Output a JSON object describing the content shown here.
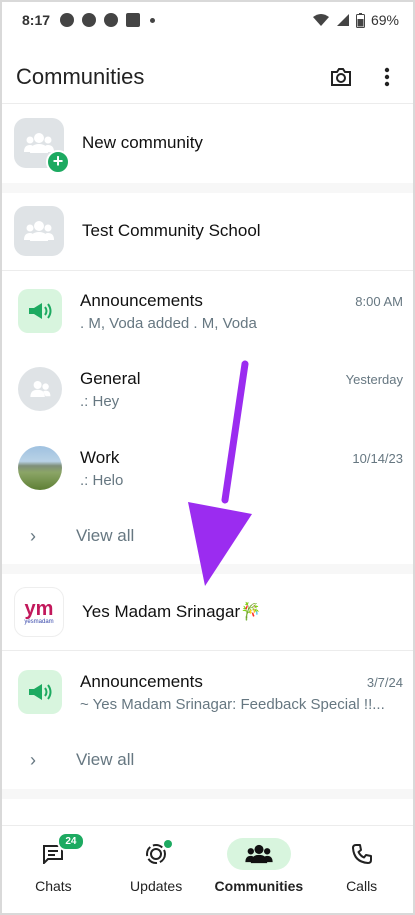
{
  "status_bar": {
    "time": "8:17",
    "battery": "69%"
  },
  "app_bar": {
    "title": "Communities",
    "icons": [
      "camera-icon",
      "more-vert-icon"
    ]
  },
  "new_community": {
    "label": "New community"
  },
  "community1": {
    "name": "Test Community School",
    "groups": [
      {
        "name": "Announcements",
        "time": "8:00 AM",
        "preview": ". M, Voda added . M, Voda",
        "icon": "megaphone-icon"
      },
      {
        "name": "General",
        "time": "Yesterday",
        "preview": ".: Hey",
        "icon": "group-icon"
      },
      {
        "name": "Work",
        "time": "10/14/23",
        "preview": ".: Helo",
        "icon": "landscape-photo"
      }
    ],
    "view_all": "View all"
  },
  "community2": {
    "name": "Yes Madam Srinagar🎋",
    "logo_text": "ym",
    "logo_sub": "yesmadam",
    "groups": [
      {
        "name": "Announcements",
        "time": "3/7/24",
        "preview": "~ Yes Madam Srinagar: Feedback Special !!...",
        "icon": "megaphone-icon"
      }
    ],
    "view_all": "View all"
  },
  "bottom_nav": {
    "items": [
      {
        "label": "Chats",
        "badge": "24"
      },
      {
        "label": "Updates"
      },
      {
        "label": "Communities"
      },
      {
        "label": "Calls"
      }
    ],
    "active": "Communities"
  },
  "colors": {
    "accent": "#1daa61",
    "active_pill": "#d8f5de",
    "annotation_arrow": "#9b2cf0"
  }
}
